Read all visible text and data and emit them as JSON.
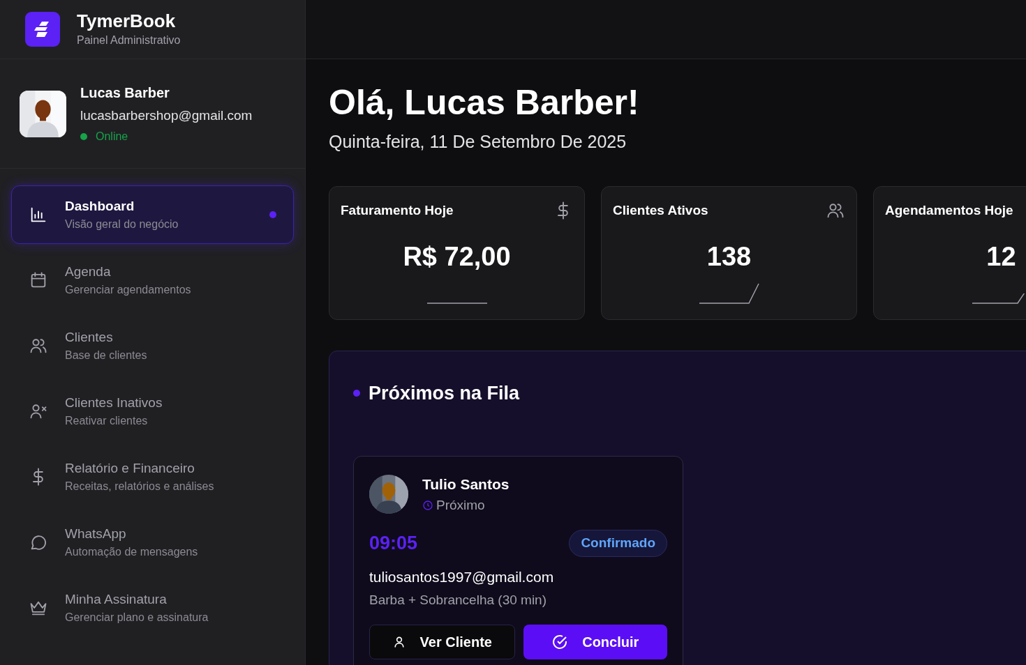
{
  "brand": {
    "name": "TymerBook",
    "subtitle": "Painel Administrativo"
  },
  "user": {
    "name": "Lucas Barber",
    "email": "lucasbarbershop@gmail.com",
    "status": "Online",
    "online": true
  },
  "nav": [
    {
      "kind": "chart",
      "title": "Dashboard",
      "subtitle": "Visão geral do negócio",
      "selected": true
    },
    {
      "kind": "calendar",
      "title": "Agenda",
      "subtitle": "Gerenciar agendamentos",
      "selected": false
    },
    {
      "kind": "users",
      "title": "Clientes",
      "subtitle": "Base de clientes",
      "selected": false
    },
    {
      "kind": "userx",
      "title": "Clientes Inativos",
      "subtitle": "Reativar clientes",
      "selected": false
    },
    {
      "kind": "dollar",
      "title": "Relatório e Financeiro",
      "subtitle": "Receitas, relatórios e análises",
      "selected": false
    },
    {
      "kind": "chat",
      "title": "WhatsApp",
      "subtitle": "Automação de mensagens",
      "selected": false
    },
    {
      "kind": "crown",
      "title": "Minha Assinatura",
      "subtitle": "Gerenciar plano e assinatura",
      "selected": false
    }
  ],
  "greeting": "Olá, Lucas Barber!",
  "date": "Quinta-feira, 11 De Setembro De 2025",
  "stats": [
    {
      "kind": "dollar",
      "title": "Faturamento Hoje",
      "value": "R$ 72,00"
    },
    {
      "kind": "users",
      "title": "Clientes Ativos",
      "value": "138"
    },
    {
      "kind": "none",
      "title": "Agendamentos Hoje",
      "value": "12"
    }
  ],
  "queue": {
    "title": "Próximos na Fila",
    "items": [
      {
        "name": "Tulio Santos",
        "position": "Próximo",
        "time": "09:05",
        "status": "Confirmado",
        "email": "tuliosantos1997@gmail.com",
        "service": "Barba + Sobrancelha (30 min)",
        "actions": [
          "Ver Cliente",
          "Concluir"
        ]
      }
    ]
  }
}
